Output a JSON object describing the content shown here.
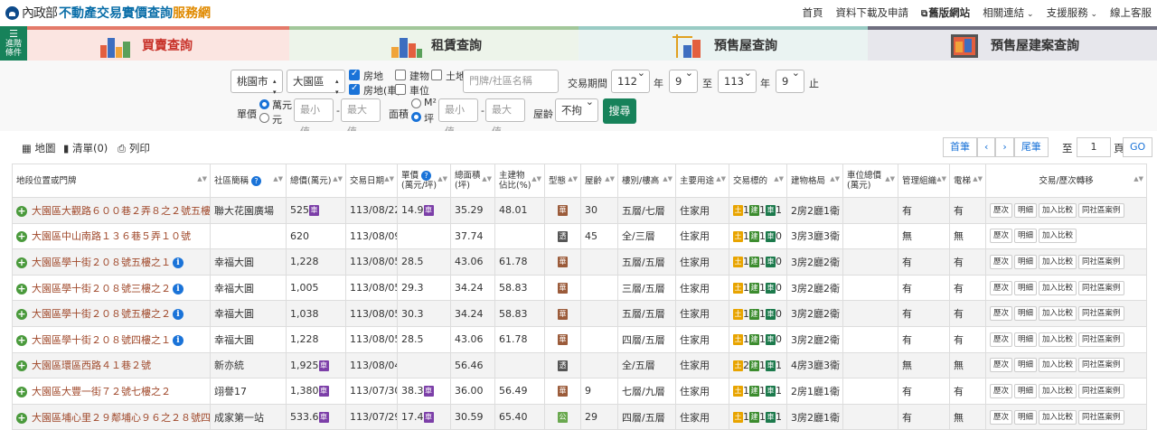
{
  "header": {
    "ministry": "內政部",
    "site_name": "不動產交易實價查詢",
    "site_suffix": "服務網",
    "nav": [
      "首頁",
      "資料下載及申請",
      "舊版網站",
      "相關連結",
      "支援服務",
      "線上客服"
    ]
  },
  "side_button": {
    "label_line1": "進階",
    "label_line2": "條件"
  },
  "tabs": [
    "買賣查詢",
    "租賃查詢",
    "預售屋查詢",
    "預售屋建案查詢"
  ],
  "filters": {
    "city": "桃園市",
    "district": "大園區",
    "types": [
      {
        "label": "房地",
        "checked": true
      },
      {
        "label": "建物",
        "checked": false
      },
      {
        "label": "土地",
        "checked": false
      },
      {
        "label": "房地(車)",
        "checked": true
      },
      {
        "label": "車位",
        "checked": false
      }
    ],
    "community_placeholder": "門牌/社區名稱",
    "period_label": "交易期間",
    "from_year": "112",
    "from_month": "9",
    "to_year": "113",
    "to_month": "9",
    "year_unit": "年",
    "to_word": "至",
    "end_word": "止",
    "unit_price_label": "單價",
    "unit_opt1": "萬元",
    "unit_opt2": "元",
    "min_placeholder": "最小值",
    "max_placeholder": "最大值",
    "area_label": "面積",
    "area_opt1": "M²",
    "area_opt2": "坪",
    "age_label": "屋齡",
    "age_value": "不拘",
    "search_label": "搜尋"
  },
  "toolbar": {
    "map": "地圖",
    "list": "清單(0)",
    "print": "列印",
    "first": "首筆",
    "prev": "‹",
    "next": "›",
    "last": "尾筆",
    "goto_label": "至",
    "page": "1",
    "page_unit": "頁",
    "go": "GO"
  },
  "columns": [
    "地段位置或門牌",
    "社區簡稱",
    "總價(萬元)",
    "交易日期",
    "單價\n(萬元/坪)",
    "總面積\n(坪)",
    "主建物\n佔比(%)",
    "型態",
    "屋齡",
    "樓別/樓高",
    "主要用途",
    "交易標的",
    "建物格局",
    "車位總價\n(萬元)",
    "管理組織",
    "電梯",
    "交易/歷次轉移"
  ],
  "rows": [
    {
      "address": "大園區大觀路６００巷２弄８之２號五樓",
      "info": false,
      "community": "聯大花園廣場",
      "price": "525",
      "price_tag": true,
      "date": "113/08/22",
      "unit": "14.9",
      "unit_tag": true,
      "area": "35.29",
      "ratio": "48.01",
      "type": "華",
      "age": "30",
      "floor": "五層/七層",
      "use": "住家用",
      "land": "1",
      "bld": "1",
      "car": "1",
      "layout": "2房2廳1衛",
      "parking": "",
      "mgmt": "有",
      "elev": "有",
      "actions": [
        "歷次",
        "明細",
        "加入比較",
        "同社區案例"
      ]
    },
    {
      "address": "大園區中山南路１３６巷５弄１０號",
      "info": false,
      "community": "",
      "price": "620",
      "price_tag": false,
      "date": "113/08/09",
      "unit": "",
      "unit_tag": false,
      "area": "37.74",
      "ratio": "",
      "type": "透",
      "age": "45",
      "floor": "全/三層",
      "use": "住家用",
      "land": "1",
      "bld": "1",
      "car": "0",
      "layout": "3房3廳3衛",
      "parking": "",
      "mgmt": "無",
      "elev": "無",
      "actions": [
        "歷次",
        "明細",
        "加入比較"
      ]
    },
    {
      "address": "大園區學十街２０８號五樓之１",
      "info": true,
      "community": "幸福大圓",
      "price": "1,228",
      "price_tag": false,
      "date": "113/08/05",
      "unit": "28.5",
      "unit_tag": false,
      "area": "43.06",
      "ratio": "61.78",
      "type": "華",
      "age": "",
      "floor": "五層/五層",
      "use": "住家用",
      "land": "1",
      "bld": "1",
      "car": "0",
      "layout": "3房2廳2衛",
      "parking": "",
      "mgmt": "有",
      "elev": "有",
      "actions": [
        "歷次",
        "明細",
        "加入比較",
        "同社區案例"
      ]
    },
    {
      "address": "大園區學十街２０８號三樓之２",
      "info": true,
      "community": "幸福大圓",
      "price": "1,005",
      "price_tag": false,
      "date": "113/08/05",
      "unit": "29.3",
      "unit_tag": false,
      "area": "34.24",
      "ratio": "58.83",
      "type": "華",
      "age": "",
      "floor": "三層/五層",
      "use": "住家用",
      "land": "1",
      "bld": "1",
      "car": "0",
      "layout": "3房2廳2衛",
      "parking": "",
      "mgmt": "有",
      "elev": "有",
      "actions": [
        "歷次",
        "明細",
        "加入比較",
        "同社區案例"
      ]
    },
    {
      "address": "大園區學十街２０８號五樓之２",
      "info": true,
      "community": "幸福大圓",
      "price": "1,038",
      "price_tag": false,
      "date": "113/08/05",
      "unit": "30.3",
      "unit_tag": false,
      "area": "34.24",
      "ratio": "58.83",
      "type": "華",
      "age": "",
      "floor": "五層/五層",
      "use": "住家用",
      "land": "1",
      "bld": "1",
      "car": "0",
      "layout": "3房2廳2衛",
      "parking": "",
      "mgmt": "有",
      "elev": "有",
      "actions": [
        "歷次",
        "明細",
        "加入比較",
        "同社區案例"
      ]
    },
    {
      "address": "大園區學十街２０８號四樓之１",
      "info": true,
      "community": "幸福大圓",
      "price": "1,228",
      "price_tag": false,
      "date": "113/08/05",
      "unit": "28.5",
      "unit_tag": false,
      "area": "43.06",
      "ratio": "61.78",
      "type": "華",
      "age": "",
      "floor": "四層/五層",
      "use": "住家用",
      "land": "1",
      "bld": "1",
      "car": "0",
      "layout": "3房2廳2衛",
      "parking": "",
      "mgmt": "有",
      "elev": "有",
      "actions": [
        "歷次",
        "明細",
        "加入比較",
        "同社區案例"
      ]
    },
    {
      "address": "大園區環區西路４１巷２號",
      "info": false,
      "community": "新亦統",
      "price": "1,925",
      "price_tag": true,
      "date": "113/08/04",
      "unit": "",
      "unit_tag": false,
      "area": "56.46",
      "ratio": "",
      "type": "透",
      "age": "",
      "floor": "全/五層",
      "use": "住家用",
      "land": "2",
      "bld": "1",
      "car": "1",
      "layout": "4房3廳3衛",
      "parking": "",
      "mgmt": "無",
      "elev": "無",
      "actions": [
        "歷次",
        "明細",
        "加入比較",
        "同社區案例"
      ]
    },
    {
      "address": "大園區大豐一街７２號七樓之２",
      "info": false,
      "community": "翊譽17",
      "price": "1,380",
      "price_tag": true,
      "date": "113/07/30",
      "unit": "38.3",
      "unit_tag": true,
      "area": "36.00",
      "ratio": "56.49",
      "type": "華",
      "age": "9",
      "floor": "七層/九層",
      "use": "住家用",
      "land": "1",
      "bld": "1",
      "car": "1",
      "layout": "2房1廳1衛",
      "parking": "",
      "mgmt": "有",
      "elev": "有",
      "actions": [
        "歷次",
        "明細",
        "加入比較",
        "同社區案例"
      ]
    },
    {
      "address": "大園區埔心里２９鄰埔心９６之２８號四樓",
      "info": false,
      "community": "成家第一站",
      "price": "533.6",
      "price_tag": true,
      "date": "113/07/29",
      "unit": "17.4",
      "unit_tag": true,
      "area": "30.59",
      "ratio": "65.40",
      "type": "公",
      "age": "29",
      "floor": "四層/五層",
      "use": "住家用",
      "land": "1",
      "bld": "1",
      "car": "1",
      "layout": "3房2廳1衛",
      "parking": "",
      "mgmt": "有",
      "elev": "無",
      "actions": [
        "歷次",
        "明細",
        "加入比較",
        "同社區案例"
      ]
    }
  ],
  "tags": {
    "price_tag": "車",
    "land": "土",
    "bld": "建",
    "car": "車"
  },
  "colors": {
    "green": "#17825a",
    "address": "#a0492b",
    "accent_red": "#c8322a"
  }
}
